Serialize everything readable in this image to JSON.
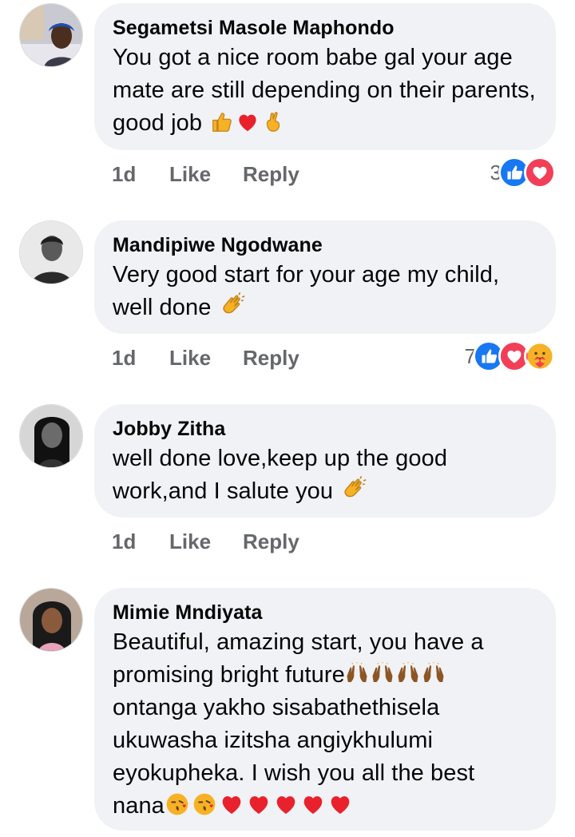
{
  "comments": [
    {
      "author": "Segametsi Masole Maphondo",
      "text": "You got a nice room babe gal your age mate are still depending on their parents, good job",
      "emoji": [
        "thumbs-up",
        "heart",
        "crossed-fingers"
      ],
      "time": "1d",
      "like_label": "Like",
      "reply_label": "Reply",
      "reaction_count": "3",
      "reactions": [
        "like",
        "love"
      ]
    },
    {
      "author": "Mandipiwe Ngodwane",
      "text": "Very good start for your age my child, well done",
      "emoji": [
        "clapping-hands"
      ],
      "time": "1d",
      "like_label": "Like",
      "reply_label": "Reply",
      "reaction_count": "7",
      "reactions": [
        "like",
        "love",
        "care"
      ]
    },
    {
      "author": "Jobby Zitha",
      "text": "well done love,keep up the good work,and I salute you",
      "emoji": [
        "clapping-hands"
      ],
      "time": "1d",
      "like_label": "Like",
      "reply_label": "Reply",
      "reaction_count": "",
      "reactions": []
    },
    {
      "author": "Mimie Mndiyata",
      "text_line1": "Beautiful, amazing start, you have a",
      "text_line2": "promising bright future",
      "text_line3": "ontanga yakho sisabathethisela ukuwasha izitsha angiykhulumi eyokupheka. I wish you all the best nana",
      "emoji_mid": [
        "raising-hands",
        "raising-hands",
        "raising-hands",
        "raising-hands"
      ],
      "emoji_end": [
        "kissing-face",
        "kissing-face",
        "heart",
        "heart",
        "heart",
        "heart",
        "heart"
      ]
    }
  ],
  "colors": {
    "bubble": "#f0f2f5",
    "meta": "#65676b",
    "like_blue": "#1877f2",
    "love_red": "#f33e58",
    "care_yellow": "#f7b125"
  }
}
